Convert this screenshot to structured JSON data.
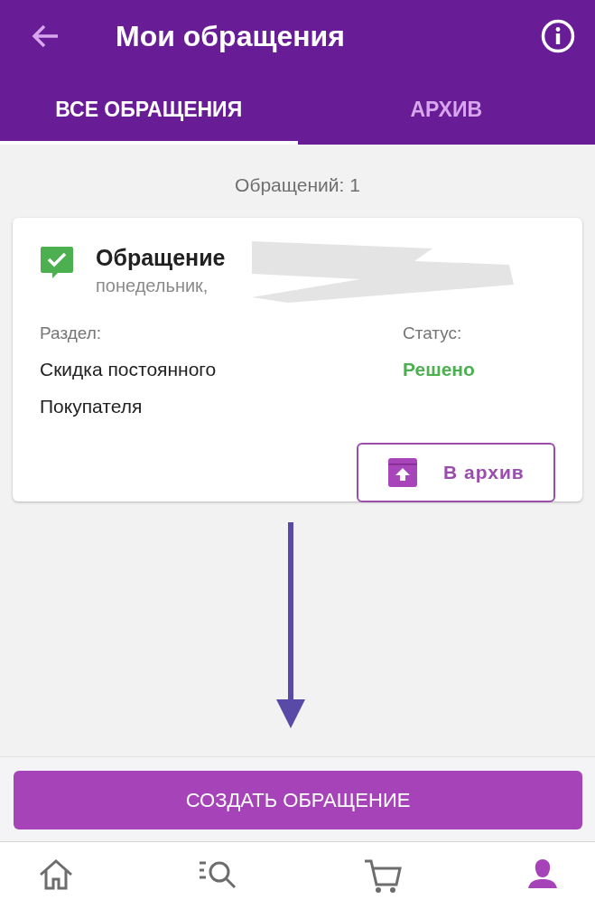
{
  "header": {
    "title": "Мои обращения"
  },
  "tabs": [
    {
      "label": "ВСЕ ОБРАЩЕНИЯ",
      "selected": true
    },
    {
      "label": "АРХИВ",
      "selected": false
    }
  ],
  "count": "Обращений: 1",
  "tickets": [
    {
      "title": "Обращение",
      "date": "понедельник,",
      "resolved": true,
      "section_label": "Раздел:",
      "section": "Скидка постоянного Покупателя",
      "status_label": "Статус:",
      "status": "Решено",
      "redacted": true,
      "archive_button": "В архив"
    }
  ],
  "annotation": {
    "kind": "arrow"
  },
  "create_button": "СОЗДАТЬ ОБРАЩЕНИЕ",
  "nav": [
    {
      "kind": "home",
      "selected": false
    },
    {
      "kind": "catalog",
      "selected": false
    },
    {
      "kind": "cart",
      "selected": false
    },
    {
      "kind": "profile",
      "selected": true
    }
  ]
}
